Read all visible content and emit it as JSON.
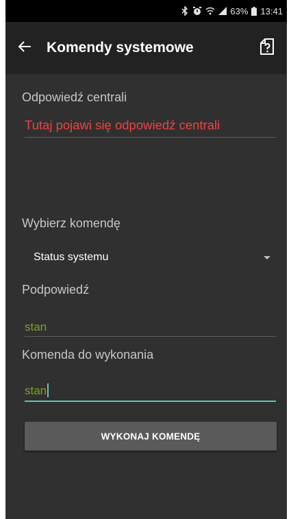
{
  "status_bar": {
    "battery": "63%",
    "time": "13:41",
    "icons": [
      "bluetooth-icon",
      "alarm-icon",
      "wifi-icon",
      "signal-icon",
      "battery-icon"
    ]
  },
  "app_bar": {
    "title": "Komendy systemowe",
    "back_icon": "arrow-left-icon",
    "help_icon": "help-doc-icon"
  },
  "response": {
    "label": "Odpowiedź centrali",
    "value": "Tutaj pojawi się odpowiedź centrali",
    "value_color": "#ef4242"
  },
  "command_select": {
    "label": "Wybierz komendę",
    "selected": "Status systemu"
  },
  "hint": {
    "label": "Podpowiedź",
    "value": "stan"
  },
  "command_input": {
    "label": "Komenda do wykonania",
    "value": "stan"
  },
  "execute_button": {
    "label": "WYKONAJ KOMENDĘ"
  },
  "colors": {
    "background": "#303030",
    "app_bar": "#222222",
    "accent": "#63c5b8",
    "green_text": "#7aa229"
  }
}
